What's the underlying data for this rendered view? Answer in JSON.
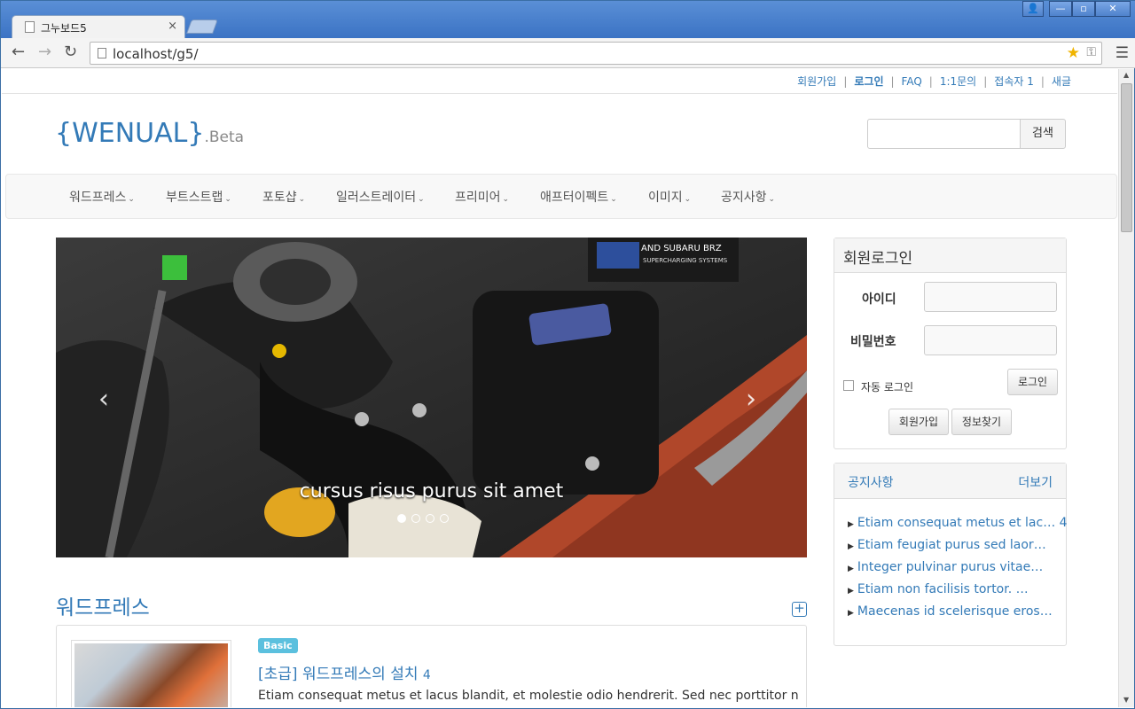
{
  "browser": {
    "tab_title": "그누보드5",
    "tab_close": "×",
    "url": "localhost/g5/",
    "window_controls": [
      "👤",
      "—",
      "▫",
      "✕"
    ]
  },
  "top_links": [
    "회원가입",
    "로그인",
    "FAQ",
    "1:1문의",
    "접속자 1",
    "새글"
  ],
  "logo": {
    "main": "{WENUAL}",
    "suffix": ".Beta"
  },
  "search": {
    "button": "검색",
    "placeholder": ""
  },
  "nav": [
    "워드프레스",
    "부트스트랩",
    "포토샵",
    "일러스트레이터",
    "프리미어",
    "애프터이펙트",
    "이미지",
    "공지사항"
  ],
  "slider": {
    "caption": "cursus risus purus sit amet",
    "slide_count": 4,
    "active_index": 0
  },
  "section": {
    "title": "워드프레스",
    "post": {
      "badge": "Basic",
      "title": "[초급] 워드프레스의 설치",
      "comment_count": "4",
      "excerpt": "Etiam consequat metus et lacus blandit, et molestie odio hendrerit. Sed nec porttitor nibh, ac"
    }
  },
  "login": {
    "title": "회원로그인",
    "id_label": "아이디",
    "pw_label": "비밀번호",
    "auto_login": "자동 로그인",
    "login_button": "로그인",
    "join_button": "회원가입",
    "find_button": "정보찾기"
  },
  "notice": {
    "title": "공지사항",
    "more": "더보기",
    "items": [
      {
        "text": "Etiam consequat metus et lac…",
        "count": "4"
      },
      {
        "text": "Etiam feugiat purus sed laor…",
        "count": ""
      },
      {
        "text": "Integer pulvinar purus vitae…",
        "count": ""
      },
      {
        "text": "Etiam non facilisis tortor. …",
        "count": ""
      },
      {
        "text": "Maecenas id scelerisque eros…",
        "count": ""
      }
    ]
  },
  "colors": {
    "link": "#337ab7",
    "badge": "#5bc0de",
    "titlebar": "#3b73c4"
  }
}
